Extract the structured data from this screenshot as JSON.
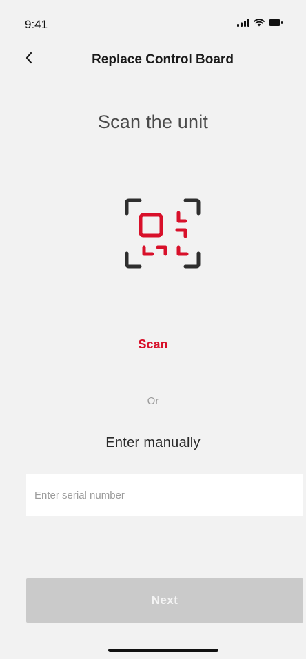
{
  "status_bar": {
    "time": "9:41",
    "icons": [
      "signal-icon",
      "wifi-icon",
      "battery-icon"
    ]
  },
  "nav": {
    "back_icon": "chevron-left-icon",
    "title": "Replace Control Board"
  },
  "main": {
    "heading": "Scan the unit",
    "scan_icon": "qr-scan-icon",
    "scan_label": "Scan",
    "or_label": "Or",
    "manual_label": "Enter manually",
    "serial_input": {
      "value": "",
      "placeholder": "Enter serial number"
    },
    "next_label": "Next"
  },
  "colors": {
    "accent": "#d8102a",
    "background": "#f2f2f2",
    "button_disabled": "#cacaca"
  }
}
